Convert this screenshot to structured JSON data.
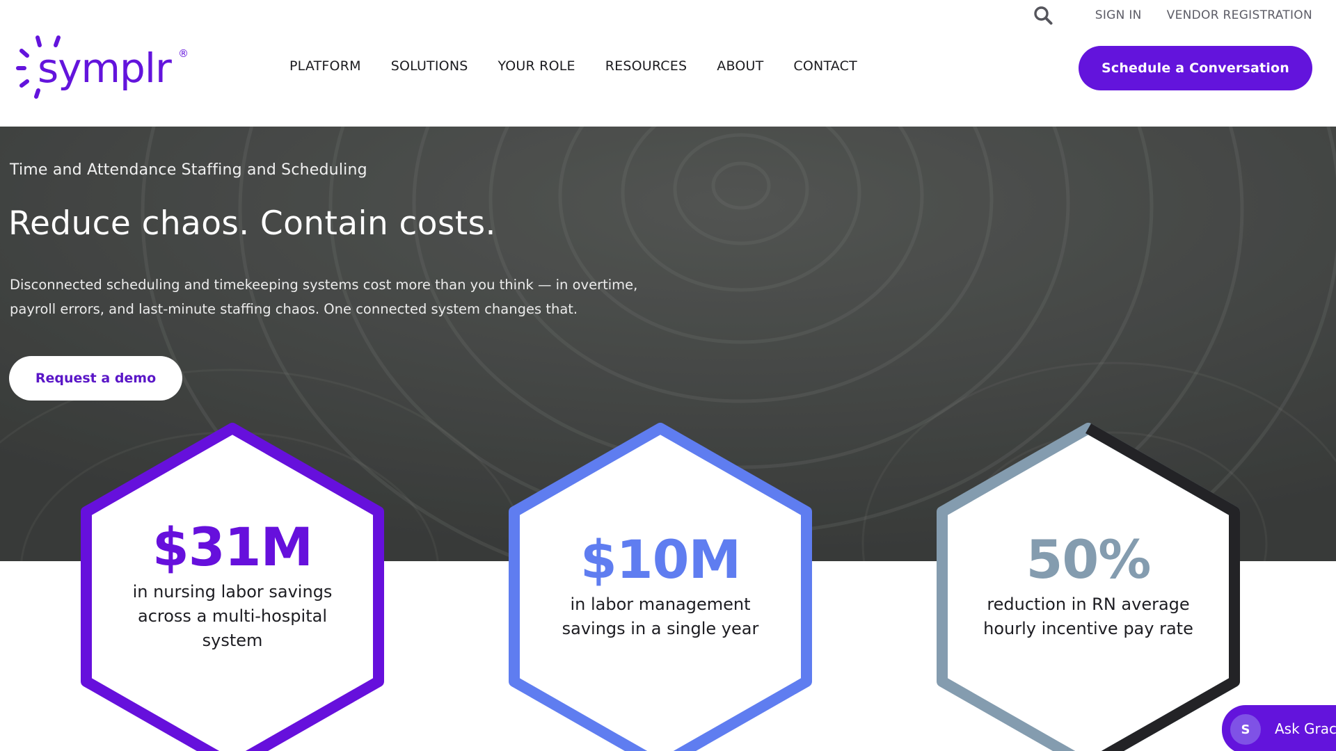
{
  "brand": {
    "name": "symplr",
    "registered_mark": "®",
    "color_primary": "#6314dc"
  },
  "utility_nav": {
    "search_icon": "search-icon",
    "sign_in": "SIGN IN",
    "vendor_registration": "VENDOR REGISTRATION"
  },
  "main_nav": {
    "items": [
      {
        "label": "PLATFORM"
      },
      {
        "label": "SOLUTIONS"
      },
      {
        "label": "YOUR ROLE"
      },
      {
        "label": "RESOURCES"
      },
      {
        "label": "ABOUT"
      },
      {
        "label": "CONTACT"
      }
    ]
  },
  "header": {
    "cta_label": "Schedule a Conversation"
  },
  "hero": {
    "eyebrow": "Time and Attendance Staffing and Scheduling",
    "title": "Reduce chaos. Contain costs.",
    "description": "Disconnected scheduling and timekeeping systems cost more than you think — in overtime, payroll errors, and last-minute staffing chaos. One connected system changes that.",
    "demo_button": "Request a demo"
  },
  "stats": [
    {
      "value": "$31M",
      "label": "in nursing labor savings across a multi-hospital system",
      "color": "#6610dc"
    },
    {
      "value": "$10M",
      "label": "in labor management savings in a single year",
      "color": "#5f7df0"
    },
    {
      "value": "50%",
      "label": "reduction in RN average hourly incentive pay rate",
      "color": "#849caf",
      "accent_color": "#232326"
    }
  ],
  "chat_widget": {
    "avatar_letter": "S",
    "label": "Ask Grac"
  }
}
